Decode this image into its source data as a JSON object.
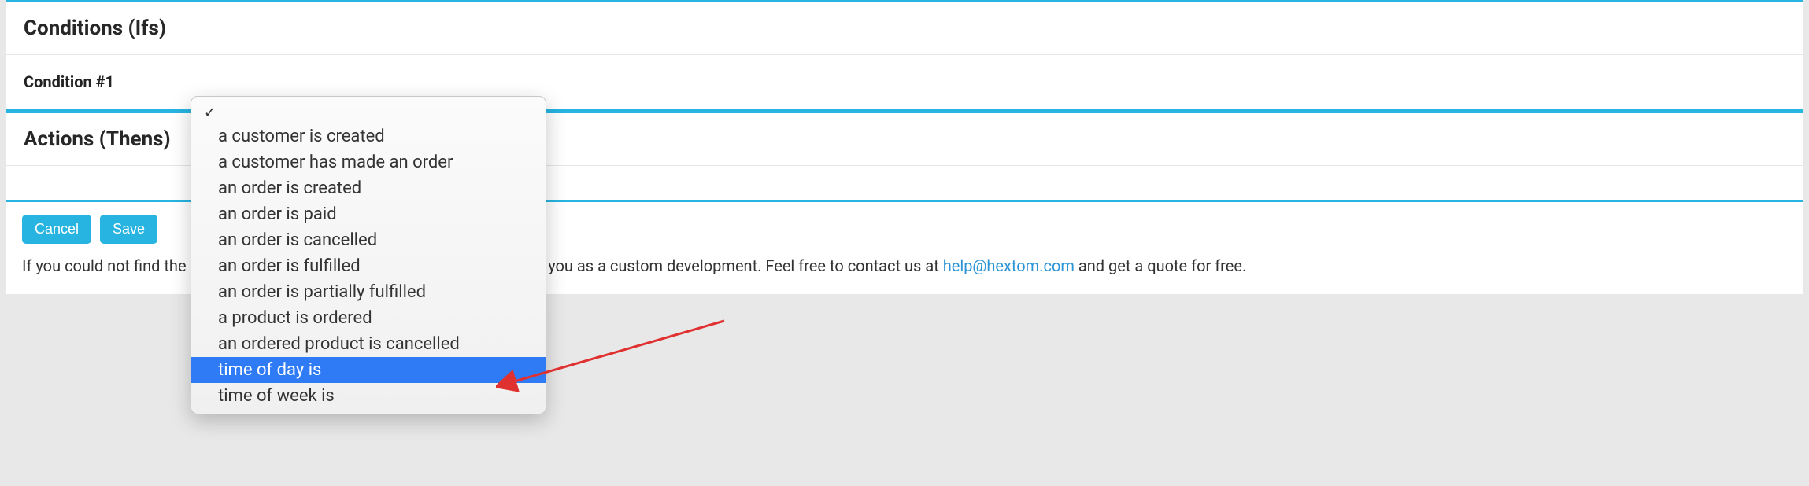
{
  "sections": {
    "conditions_title": "Conditions (Ifs)",
    "condition_label": "Condition #1",
    "actions_title": "Actions (Thens)"
  },
  "buttons": {
    "cancel": "Cancel",
    "save": "Save"
  },
  "footer": {
    "before_link": "If you could not find the condition/action you need, we can implement it for you as a custom development. Feel free to contact us at ",
    "link_text": "help@hextom.com",
    "after_link": " and get a quote for free."
  },
  "dropdown": {
    "options": [
      "a customer is created",
      "a customer has made an order",
      "an order is created",
      "an order is paid",
      "an order is cancelled",
      "an order is fulfilled",
      "an order is partially fulfilled",
      "a product is ordered",
      "an ordered product is cancelled",
      "time of day is",
      "time of week is"
    ],
    "selected_index": 9
  }
}
